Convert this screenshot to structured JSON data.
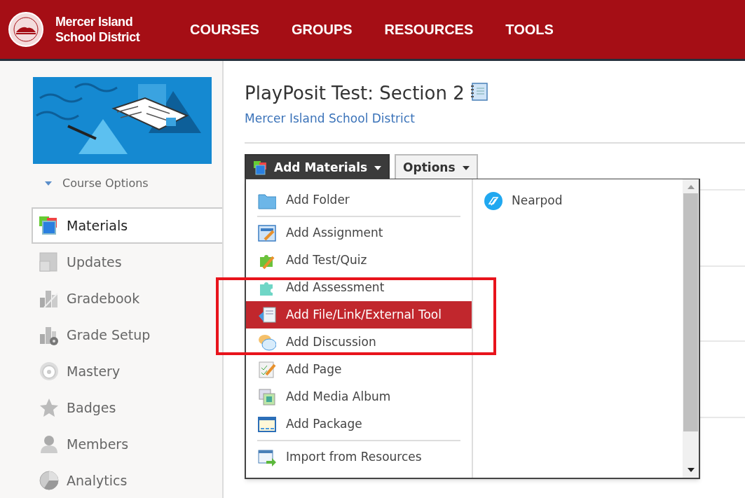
{
  "header": {
    "logo_text": [
      "Mercer Island",
      "School District"
    ],
    "nav": [
      "COURSES",
      "GROUPS",
      "RESOURCES",
      "TOOLS"
    ]
  },
  "sidebar": {
    "course_options": "Course Options",
    "items": [
      {
        "label": "Materials",
        "selected": true
      },
      {
        "label": "Updates",
        "selected": false
      },
      {
        "label": "Gradebook",
        "selected": false
      },
      {
        "label": "Grade Setup",
        "selected": false
      },
      {
        "label": "Mastery",
        "selected": false
      },
      {
        "label": "Badges",
        "selected": false
      },
      {
        "label": "Members",
        "selected": false
      },
      {
        "label": "Analytics",
        "selected": false
      }
    ]
  },
  "main": {
    "title": "PlayPosit Test: Section 2",
    "subtitle": "Mercer Island School District",
    "buttons": [
      {
        "label": "Add Materials",
        "selected": true
      },
      {
        "label": "Options",
        "selected": false
      }
    ]
  },
  "menu": {
    "groups": [
      [
        {
          "label": "Add Folder",
          "selected": false
        }
      ],
      [
        {
          "label": "Add Assignment",
          "selected": false
        },
        {
          "label": "Add Test/Quiz",
          "selected": false
        },
        {
          "label": "Add Assessment",
          "selected": false
        },
        {
          "label": "Add File/Link/External Tool",
          "selected": true
        },
        {
          "label": "Add Discussion",
          "selected": false
        },
        {
          "label": "Add Page",
          "selected": false
        },
        {
          "label": "Add Media Album",
          "selected": false
        },
        {
          "label": "Add Package",
          "selected": false
        }
      ],
      [
        {
          "label": "Import from Resources",
          "selected": false
        }
      ]
    ],
    "apps": [
      "Nearpod"
    ]
  }
}
